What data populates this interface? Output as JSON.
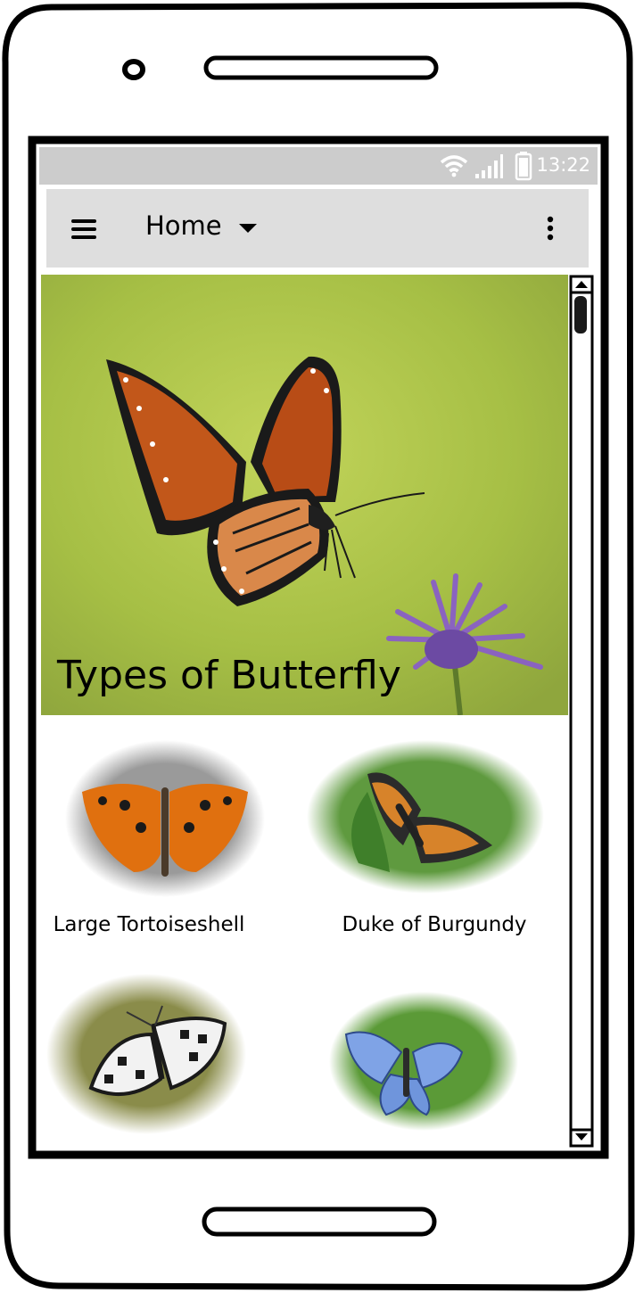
{
  "status_bar": {
    "time": "13:22",
    "icons": [
      "wifi-icon",
      "signal-icon",
      "battery-icon"
    ]
  },
  "app_bar": {
    "title": "Home",
    "icons": [
      "menu-icon",
      "dropdown-icon",
      "overflow-menu-icon"
    ]
  },
  "hero": {
    "title": "Types of Butterfly"
  },
  "butterflies": [
    {
      "name": "Large Tortoiseshell"
    },
    {
      "name": "Duke of Burgundy"
    },
    {
      "name": ""
    },
    {
      "name": ""
    }
  ],
  "colors": {
    "status_bar_bg": "#cccccc",
    "app_bar_bg": "#dedede",
    "hero_bg": "#a9c24a"
  }
}
